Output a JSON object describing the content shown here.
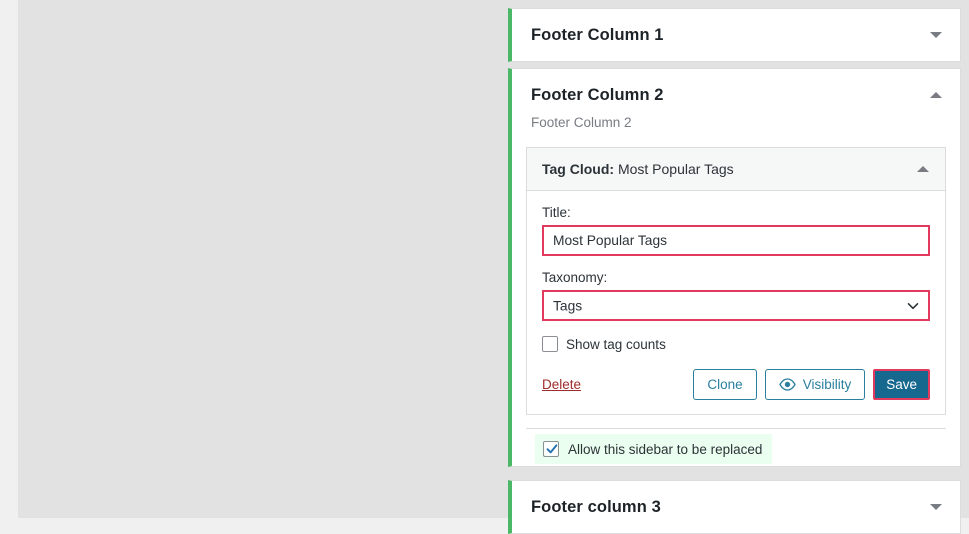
{
  "panels": [
    {
      "id": "footer-column-1",
      "title": "Footer Column 1",
      "state": "collapsed",
      "caret": "chevron-down-icon"
    },
    {
      "id": "footer-column-2",
      "title": "Footer Column 2",
      "description": "Footer Column 2",
      "state": "expanded",
      "caret": "chevron-up-icon"
    },
    {
      "id": "footer-column-3",
      "title": "Footer column 3",
      "state": "collapsed",
      "caret": "chevron-down-icon"
    }
  ],
  "widget": {
    "type_label": "Tag Cloud:",
    "instance_title": "Most Popular Tags",
    "caret": "chevron-up-icon",
    "fields": {
      "title": {
        "label": "Title:",
        "value": "Most Popular Tags",
        "placeholder": ""
      },
      "taxonomy": {
        "label": "Taxonomy:",
        "value": "Tags",
        "options": [
          "Tags"
        ]
      },
      "show_counts": {
        "label": "Show tag counts",
        "checked": false
      }
    },
    "actions": {
      "delete_label": "Delete",
      "clone_label": "Clone",
      "visibility_label": "Visibility",
      "visibility_icon": "eye-icon",
      "save_label": "Save"
    }
  },
  "sidebar_replace": {
    "label": "Allow this sidebar to be replaced",
    "checked": true
  },
  "colors": {
    "panel_accent": "#4ab866",
    "highlight_border": "#e2395f",
    "primary_button_bg": "#16688f",
    "secondary_button_border": "#2a7f9e",
    "delete_link": "#a02d2d",
    "replace_row_highlight": "#eaffef",
    "canvas_background": "#e2e2e2",
    "rail_background": "#f0f0f1"
  }
}
